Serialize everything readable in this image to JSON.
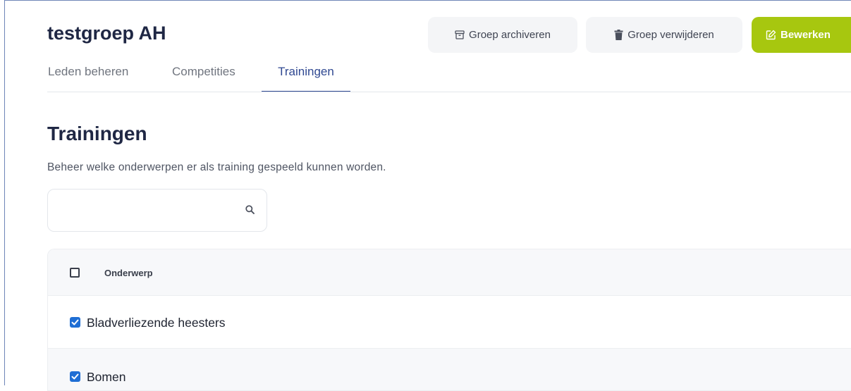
{
  "group": {
    "title": "testgroep AH"
  },
  "actions": {
    "archive_label": "Groep archiveren",
    "delete_label": "Groep verwijderen",
    "edit_label": "Bewerken",
    "edit_color": "#a7c70f"
  },
  "tabs": [
    {
      "label": "Leden beheren",
      "active": false
    },
    {
      "label": "Competities",
      "active": false
    },
    {
      "label": "Trainingen",
      "active": true
    }
  ],
  "section": {
    "title": "Trainingen",
    "description": "Beheer welke onderwerpen er als training gespeeld kunnen worden."
  },
  "search": {
    "value": "",
    "placeholder": "",
    "icon": "search-icon"
  },
  "table": {
    "header": {
      "label": "Onderwerp",
      "checked": false
    },
    "rows": [
      {
        "label": "Bladverliezende heesters",
        "checked": true
      },
      {
        "label": "Bomen",
        "checked": true
      }
    ]
  },
  "colors": {
    "accent": "#2f4891",
    "checkbox": "#1f6ed4"
  }
}
